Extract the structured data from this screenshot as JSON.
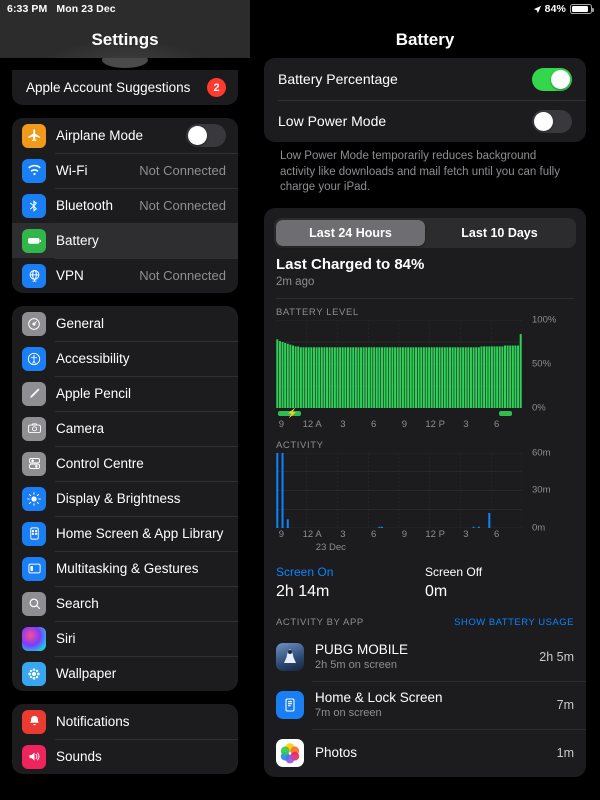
{
  "status_bar": {
    "time": "6:33 PM",
    "date": "Mon 23 Dec",
    "location_icon": "location-arrow-icon",
    "battery_percent": "84%",
    "battery_level": 84
  },
  "sidebar": {
    "title": "Settings",
    "groups": [
      {
        "items": [
          {
            "label": "Apple Account Suggestions",
            "badge": "2",
            "icon": null,
            "type": "plain"
          }
        ]
      },
      {
        "items": [
          {
            "label": "Airplane Mode",
            "icon": "airplane-icon",
            "icon_color": "#f09a1b",
            "toggle": false
          },
          {
            "label": "Wi-Fi",
            "icon": "wifi-icon",
            "icon_color": "#1a7ef5",
            "value": "Not Connected"
          },
          {
            "label": "Bluetooth",
            "icon": "bluetooth-icon",
            "icon_color": "#1a7ef5",
            "value": "Not Connected"
          },
          {
            "label": "Battery",
            "icon": "battery-icon",
            "icon_color": "#30b64a",
            "selected": true
          },
          {
            "label": "VPN",
            "icon": "vpn-globe-icon",
            "icon_color": "#1a7ef5",
            "value": "Not Connected"
          }
        ]
      },
      {
        "items": [
          {
            "label": "General",
            "icon": "gear-icon",
            "icon_color": "#8e8e93"
          },
          {
            "label": "Accessibility",
            "icon": "accessibility-icon",
            "icon_color": "#1a7ef5"
          },
          {
            "label": "Apple Pencil",
            "icon": "pencil-icon",
            "icon_color": "#8e8e93"
          },
          {
            "label": "Camera",
            "icon": "camera-icon",
            "icon_color": "#8e8e93"
          },
          {
            "label": "Control Centre",
            "icon": "control-centre-icon",
            "icon_color": "#8e8e93"
          },
          {
            "label": "Display & Brightness",
            "icon": "brightness-icon",
            "icon_color": "#1a7ef5"
          },
          {
            "label": "Home Screen & App Library",
            "icon": "home-screen-icon",
            "icon_color": "#1a7ef5"
          },
          {
            "label": "Multitasking & Gestures",
            "icon": "multitasking-icon",
            "icon_color": "#1a7ef5"
          },
          {
            "label": "Search",
            "icon": "search-icon",
            "icon_color": "#8e8e93"
          },
          {
            "label": "Siri",
            "icon": "siri-icon",
            "icon_color": "#b14bd8"
          },
          {
            "label": "Wallpaper",
            "icon": "wallpaper-icon",
            "icon_color": "#39a7f0"
          }
        ]
      },
      {
        "items": [
          {
            "label": "Notifications",
            "icon": "bell-icon",
            "icon_color": "#eb3b30"
          },
          {
            "label": "Sounds",
            "icon": "speaker-icon",
            "icon_color": "#f0245c"
          }
        ]
      }
    ]
  },
  "detail": {
    "title": "Battery",
    "toggles": [
      {
        "label": "Battery Percentage",
        "on": true
      },
      {
        "label": "Low Power Mode",
        "on": false
      }
    ],
    "footnote": "Low Power Mode temporarily reduces background activity like downloads and mail fetch until you can fully charge your iPad.",
    "segmented": {
      "options": [
        "Last 24 Hours",
        "Last 10 Days"
      ],
      "selected_index": 0
    },
    "last_charged_title": "Last Charged to 84%",
    "last_charged_sub": "2m ago",
    "battery_level_label": "BATTERY LEVEL",
    "activity_label": "ACTIVITY",
    "activity_date_label": "23 Dec",
    "stats": [
      {
        "label": "Screen On",
        "value": "2h 14m"
      },
      {
        "label": "Screen Off",
        "value": "0m"
      }
    ],
    "activity_by_app_label": "ACTIVITY BY APP",
    "show_battery_usage_link": "SHOW BATTERY USAGE",
    "apps": [
      {
        "name": "PUBG MOBILE",
        "subtitle": "2h 5m on screen",
        "time": "2h 5m",
        "icon": "pubg-app-icon"
      },
      {
        "name": "Home & Lock Screen",
        "subtitle": "7m on screen",
        "time": "7m",
        "icon": "home-lock-screen-app-icon"
      },
      {
        "name": "Photos",
        "subtitle": "",
        "time": "1m",
        "icon": "photos-app-icon"
      }
    ]
  },
  "chart_data": [
    {
      "type": "bar",
      "title": "BATTERY LEVEL",
      "id": "battery-level",
      "ylabel": "",
      "xlabel": "",
      "ylim": [
        0,
        100
      ],
      "ytick_labels": [
        "100%",
        "50%",
        "0%"
      ],
      "ytick_values": [
        100,
        50,
        0
      ],
      "xtick_labels": [
        "9",
        "12 A",
        "3",
        "6",
        "9",
        "12 P",
        "3",
        "6"
      ],
      "color": "#30d158",
      "grid": true,
      "values": [
        78,
        76,
        75,
        74,
        73,
        72,
        71,
        70,
        70,
        69,
        69,
        69,
        69,
        69,
        69,
        69,
        69,
        69,
        69,
        69,
        69,
        69,
        69,
        69,
        69,
        69,
        69,
        69,
        69,
        69,
        69,
        69,
        69,
        69,
        69,
        69,
        69,
        69,
        69,
        69,
        69,
        69,
        69,
        69,
        69,
        69,
        69,
        69,
        69,
        69,
        69,
        69,
        69,
        69,
        69,
        69,
        69,
        69,
        69,
        69,
        69,
        69,
        69,
        69,
        69,
        69,
        69,
        69,
        69,
        69,
        69,
        69,
        69,
        69,
        69,
        69,
        69,
        69,
        70,
        70,
        70,
        70,
        70,
        70,
        70,
        70,
        70,
        71,
        71,
        71,
        71,
        71,
        71,
        84
      ],
      "charging_periods": [
        {
          "start_pct": 1,
          "end_pct": 10
        },
        {
          "start_pct": 90.5,
          "end_pct": 96
        }
      ]
    },
    {
      "type": "bar",
      "title": "ACTIVITY",
      "id": "activity",
      "ylabel": "",
      "xlabel": "",
      "ylim": [
        0,
        60
      ],
      "ytick_labels": [
        "60m",
        "30m",
        "0m"
      ],
      "ytick_values": [
        60,
        30,
        0
      ],
      "xtick_labels": [
        "9",
        "12 A",
        "3",
        "6",
        "9",
        "12 P",
        "3",
        "6"
      ],
      "xtick_sub_label": "23 Dec",
      "color": "#0a84ff",
      "grid": true,
      "values": [
        60,
        0,
        60,
        0,
        7,
        0,
        0,
        0,
        0,
        0,
        0,
        0,
        0,
        0,
        0,
        0,
        0,
        0,
        0,
        0,
        0,
        0,
        0,
        0,
        0,
        0,
        0,
        0,
        0,
        0,
        0,
        0,
        0,
        0,
        0,
        0,
        0,
        0,
        0,
        1,
        1,
        0,
        0,
        0,
        0,
        0,
        0,
        0,
        0,
        0,
        0,
        0,
        0,
        0,
        0,
        0,
        0,
        0,
        0,
        0,
        0,
        0,
        0,
        0,
        0,
        0,
        0,
        0,
        0,
        0,
        0,
        0,
        0,
        0,
        0,
        1,
        0,
        1,
        0,
        0,
        0,
        12,
        0,
        0,
        0,
        0,
        0,
        0,
        0,
        0,
        0,
        0,
        0,
        0
      ]
    }
  ]
}
